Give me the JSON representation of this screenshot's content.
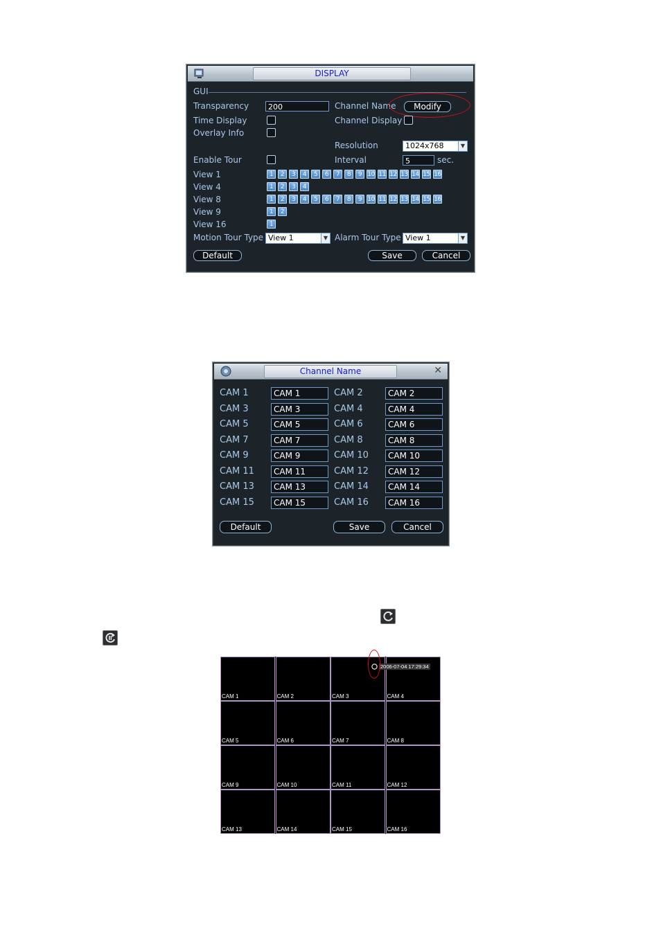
{
  "display_panel": {
    "title": "DISPLAY",
    "section": "GUI",
    "transparency_label": "Transparency",
    "transparency_value": "200",
    "channel_name_label": "Channel Name",
    "modify_button": "Modify",
    "time_display_label": "Time Display",
    "channel_display_label": "Channel Display",
    "overlay_info_label": "Overlay Info",
    "resolution_label": "Resolution",
    "resolution_value": "1024x768",
    "enable_tour_label": "Enable Tour",
    "interval_label": "Interval",
    "interval_value": "5",
    "interval_unit": "sec.",
    "views": [
      {
        "label": "View 1",
        "channels": [
          "1",
          "2",
          "3",
          "4",
          "5",
          "6",
          "7",
          "8",
          "9",
          "10",
          "11",
          "12",
          "13",
          "14",
          "15",
          "16"
        ]
      },
      {
        "label": "View 4",
        "channels": [
          "1",
          "2",
          "3",
          "4"
        ]
      },
      {
        "label": "View 8",
        "channels": [
          "1",
          "2",
          "3",
          "4",
          "5",
          "6",
          "7",
          "8",
          "9",
          "10",
          "11",
          "12",
          "13",
          "14",
          "15",
          "16"
        ]
      },
      {
        "label": "View 9",
        "channels": [
          "1",
          "2"
        ]
      },
      {
        "label": "View 16",
        "channels": [
          "1"
        ]
      }
    ],
    "motion_tour_label": "Motion Tour Type",
    "motion_tour_value": "View 1",
    "alarm_tour_label": "Alarm Tour Type",
    "alarm_tour_value": "View 1",
    "default_button": "Default",
    "save_button": "Save",
    "cancel_button": "Cancel"
  },
  "channel_name_panel": {
    "title": "Channel Name",
    "close": "✕",
    "rows": [
      {
        "l1": "CAM 1",
        "v1": "CAM 1",
        "l2": "CAM 2",
        "v2": "CAM 2"
      },
      {
        "l1": "CAM 3",
        "v1": "CAM 3",
        "l2": "CAM 4",
        "v2": "CAM 4"
      },
      {
        "l1": "CAM 5",
        "v1": "CAM 5",
        "l2": "CAM 6",
        "v2": "CAM 6"
      },
      {
        "l1": "CAM 7",
        "v1": "CAM 7",
        "l2": "CAM 8",
        "v2": "CAM 8"
      },
      {
        "l1": "CAM 9",
        "v1": "CAM 9",
        "l2": "CAM 10",
        "v2": "CAM 10"
      },
      {
        "l1": "CAM 11",
        "v1": "CAM 11",
        "l2": "CAM 12",
        "v2": "CAM 12"
      },
      {
        "l1": "CAM 13",
        "v1": "CAM 13",
        "l2": "CAM 14",
        "v2": "CAM 14"
      },
      {
        "l1": "CAM 15",
        "v1": "CAM 15",
        "l2": "CAM 16",
        "v2": "CAM 16"
      }
    ],
    "default_button": "Default",
    "save_button": "Save",
    "cancel_button": "Cancel"
  },
  "preview": {
    "timestamp": "2006-07-04 17:29:34",
    "cells": [
      "CAM 1",
      "CAM 2",
      "CAM 3",
      "CAM 4",
      "CAM 5",
      "CAM 6",
      "CAM 7",
      "CAM 8",
      "CAM 9",
      "CAM 10",
      "CAM 11",
      "CAM 12",
      "CAM 13",
      "CAM 14",
      "CAM 15",
      "CAM 16"
    ]
  }
}
